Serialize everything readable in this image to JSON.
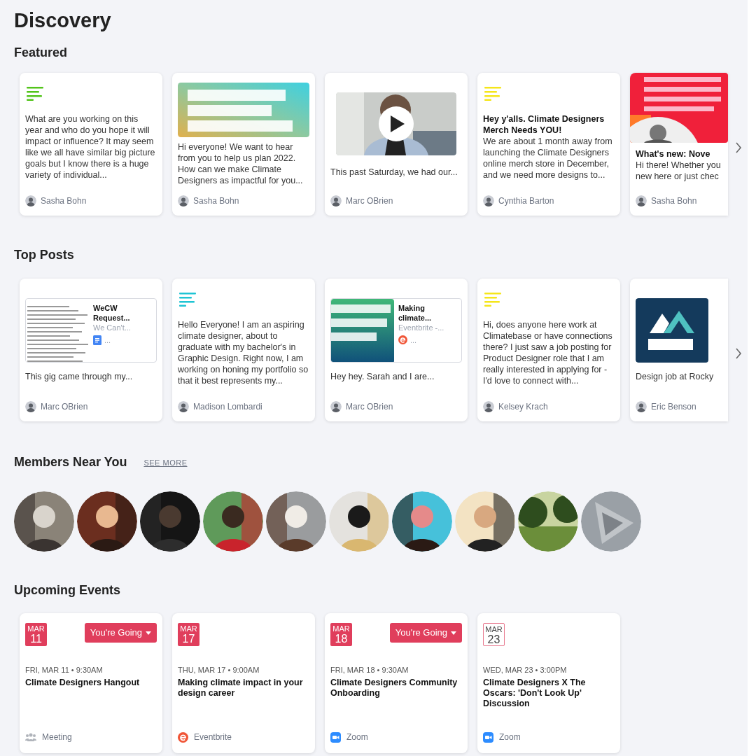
{
  "page_title": "Discovery",
  "featured": {
    "title": "Featured",
    "cards": [
      {
        "kind": "text",
        "color": "#52c41a",
        "text": "What are you working on this year and who do you hope it will impact or influence? It may seem like we all have similar big picture goals but I know there is a huge variety of individual...",
        "author": "Sasha Bohn"
      },
      {
        "text": "Hi everyone! We want to hear from you to help us plan 2022. How can we make Climate Designers as impactful for you...",
        "author": "Sasha Bohn"
      },
      {
        "kind": "video",
        "text": "This past Saturday, we had our...",
        "author": "Marc OBrien"
      },
      {
        "kind": "titled",
        "color": "#f5e61a",
        "title": "Hey y'alls. Climate Designers Merch Needs YOU!",
        "text": "We are about 1 month away from launching the Climate Designers online merch store in December, and we need more designs to...",
        "author": "Cynthia Barton"
      },
      {
        "title": "What's new: Nove",
        "text": "Hi there! Whether you\nnew here or just chec",
        "author": "Sasha Bohn"
      }
    ]
  },
  "top_posts": {
    "title": "Top Posts",
    "cards": [
      {
        "kind": "link",
        "preview": {
          "title": "WeCW Request...",
          "subtitle": "We Can't...",
          "kind": "doc",
          "more": "..."
        },
        "text": "This gig came through my...",
        "author": "Marc OBrien"
      },
      {
        "kind": "text",
        "color": "#1fc4d4",
        "text": "Hello Everyone!  I am an aspiring climate designer, about to graduate with my bachelor's in Graphic Design. Right now, I am working on honing my portfolio so that it best represents my...",
        "author": "Madison Lombardi"
      },
      {
        "kind": "link",
        "preview": {
          "title": "Making climate...",
          "subtitle": "Eventbrite -...",
          "kind": "eventbrite",
          "more": "..."
        },
        "text": "Hey hey. Sarah and I are...",
        "author": "Marc OBrien"
      },
      {
        "kind": "text",
        "color": "#f5e61a",
        "text": "Hi, does anyone here work at Climatebase or have connections there? I just saw a job posting for  Product Designer role that I am really interested in applying for - I'd love to connect with...",
        "author": "Kelsey Krach"
      },
      {
        "kind": "link",
        "preview": {
          "kind": "logo"
        },
        "text": "Design job at Rocky",
        "author": "Eric Benson"
      }
    ]
  },
  "members": {
    "title": "Members Near You",
    "see_more": "SEE MORE"
  },
  "events": {
    "title": "Upcoming Events",
    "cards": [
      {
        "month": "MAR",
        "day": "11",
        "badge_filled": true,
        "rsvp": "You're Going",
        "when": "FRI, MAR 11 • 9:30AM",
        "title": "Climate Designers Hangout",
        "location": {
          "kind": "meeting",
          "label": "Meeting"
        }
      },
      {
        "month": "MAR",
        "day": "17",
        "badge_filled": true,
        "when": "THU, MAR 17 • 9:00AM",
        "title": "Making climate impact in your design career",
        "location": {
          "kind": "eventbrite",
          "label": "Eventbrite"
        }
      },
      {
        "month": "MAR",
        "day": "18",
        "badge_filled": true,
        "rsvp": "You're Going",
        "when": "FRI, MAR 18 • 9:30AM",
        "title": "Climate Designers Community Onboarding",
        "location": {
          "kind": "zoom",
          "label": "Zoom"
        }
      },
      {
        "month": "MAR",
        "day": "23",
        "badge_filled": false,
        "when": "WED, MAR 23 • 3:00PM",
        "title": "Climate Designers X The Oscars: 'Don't Look Up' Discussion",
        "location": {
          "kind": "zoom",
          "label": "Zoom"
        }
      }
    ]
  }
}
